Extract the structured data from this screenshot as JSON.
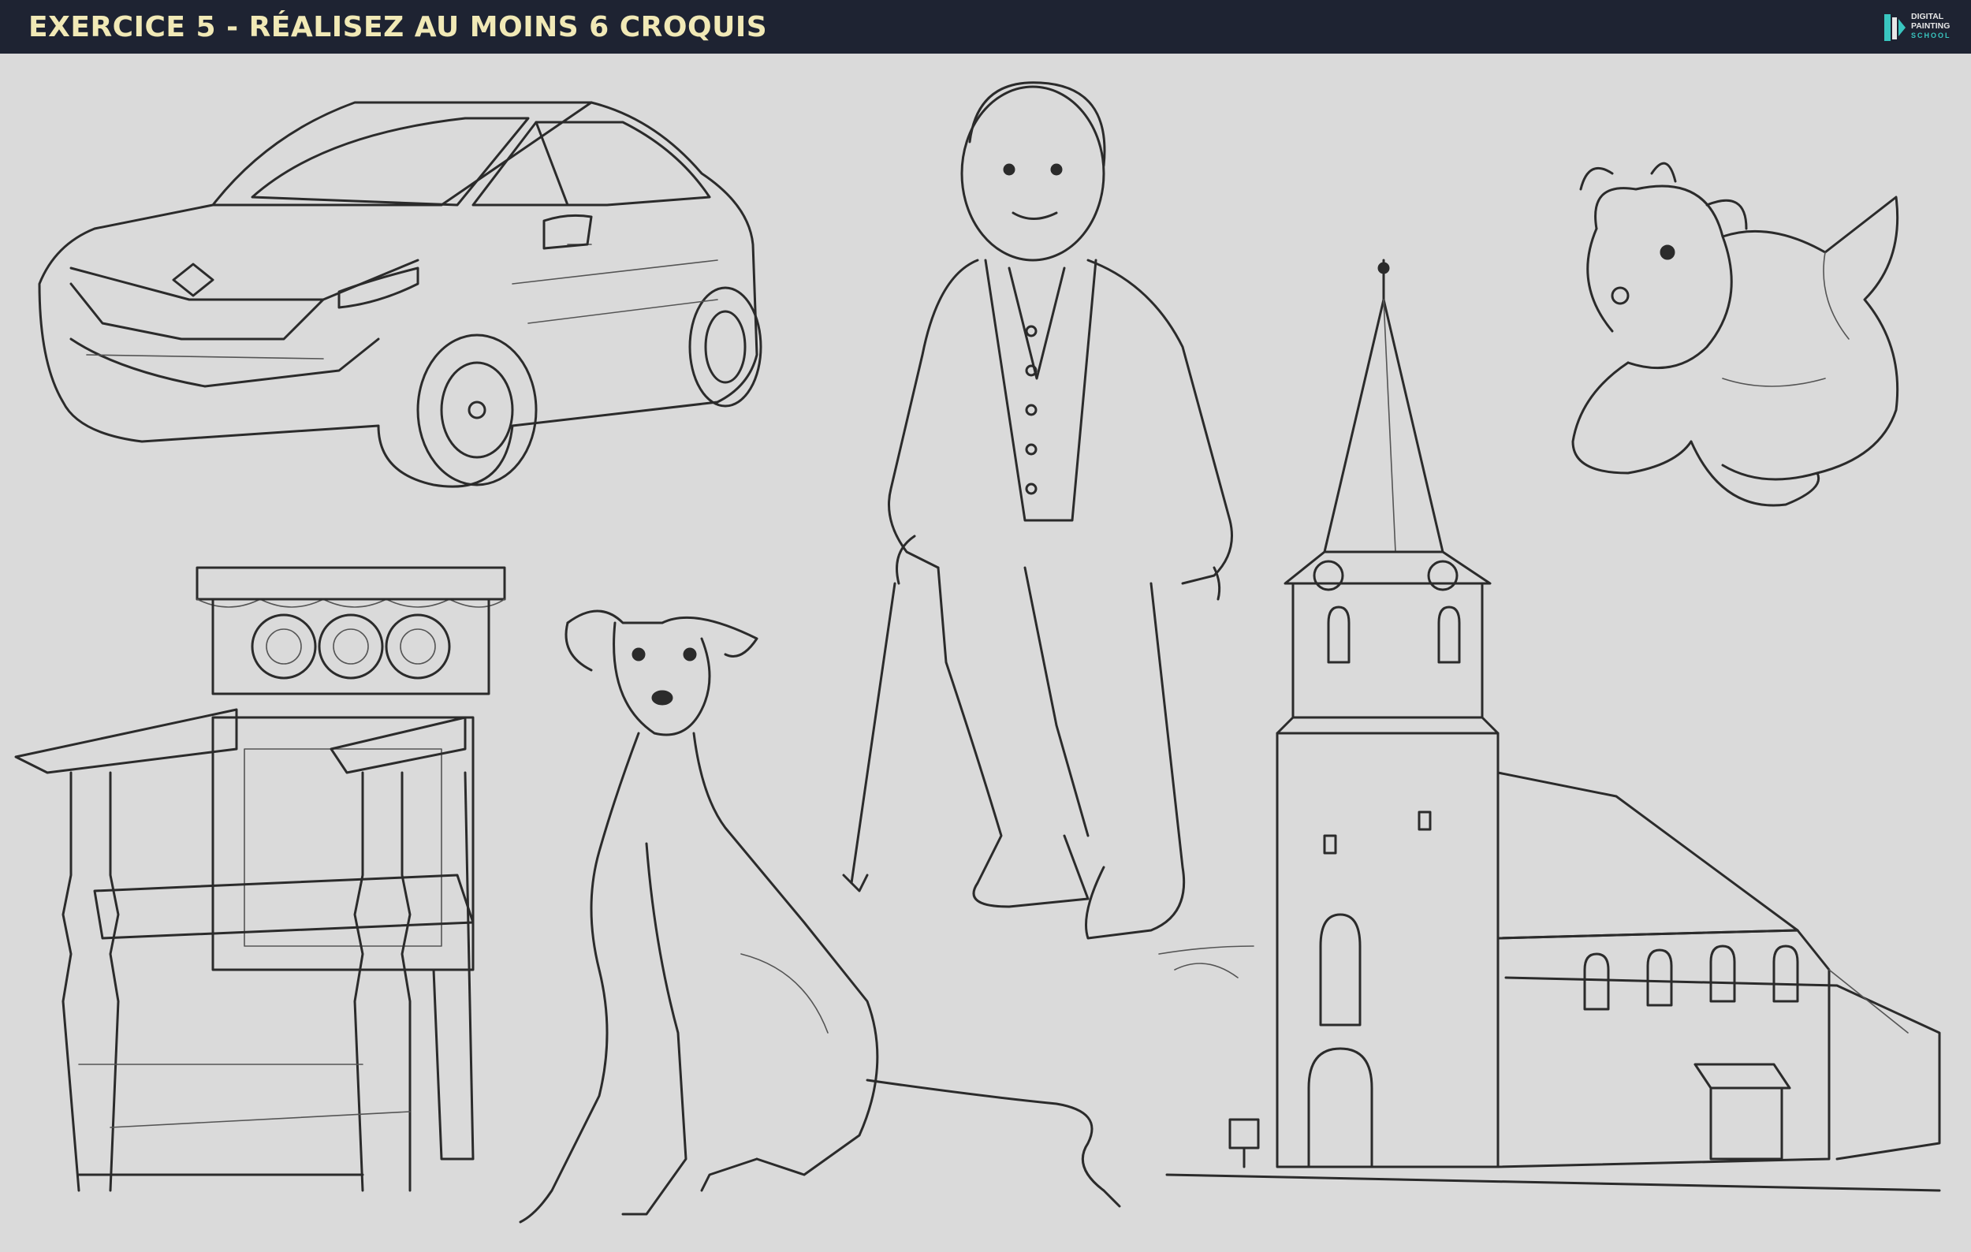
{
  "header": {
    "title": "EXERCICE 5 - RÉALISEZ AU MOINS 6 CROQUIS",
    "logo": {
      "line1": "DIGITAL",
      "line2": "PAINTING",
      "line3": "SCHOOL"
    }
  },
  "colors": {
    "header_bg": "#1e2332",
    "title": "#f1e9b6",
    "canvas_bg": "#dadada",
    "ink": "#2b2b2b",
    "logo_accent": "#39c6c0"
  },
  "sketches": [
    "car-sketch",
    "old-man-with-cane-sketch",
    "plush-dragon-sketch",
    "wooden-armchair-sketch",
    "greyhound-dog-sketch",
    "church-sketch"
  ]
}
